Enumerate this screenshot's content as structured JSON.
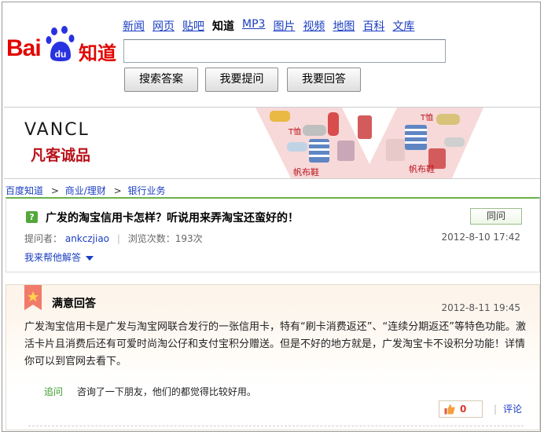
{
  "header": {
    "logo_text_latin": "Bai",
    "logo_text_du": "du",
    "logo_text_cn": "知道",
    "nav": [
      "新闻",
      "网页",
      "贴吧",
      "知道",
      "MP3",
      "图片",
      "视频",
      "地图",
      "百科",
      "文库"
    ],
    "nav_active_index": 3,
    "search_value": "",
    "buttons": {
      "search": "搜索答案",
      "ask": "我要提问",
      "answer": "我要回答"
    }
  },
  "banner": {
    "brand": "VANCL",
    "slogan": "凡客诚品",
    "product_labels": [
      "T恤",
      "T恤",
      "帆布鞋",
      "帆布鞋"
    ]
  },
  "breadcrumb": [
    "百度知道",
    "商业/理财",
    "银行业务"
  ],
  "question": {
    "icon": "question-icon",
    "title": "广发的淘宝信用卡怎样？听说用来弄淘宝还蛮好的！",
    "same_button": "同问",
    "asker_label": "提问者：",
    "asker": "ankczjiao",
    "views_label": "浏览次数：",
    "views": "193次",
    "date": "2012-8-10 17:42",
    "help_link": "我来帮他解答"
  },
  "answer": {
    "title": "满意回答",
    "date": "2012-8-11 19:45",
    "body": "广发淘宝信用卡是广发与淘宝网联合发行的一张信用卡，特有“刷卡消费返还”、“连续分期返还”等特色功能。激活卡片且消费后还有可爱时尚淘公仔和支付宝积分赠送。但是不好的地方就是，广发淘宝卡不设积分功能！详情你可以到官网去看下。",
    "followup_tag": "追问",
    "followup_text": "咨询了一下朋友，他们的都觉得比较好用。",
    "likes": "0",
    "comment_link": "评论"
  },
  "colors": {
    "baidu_red": "#e10602",
    "baidu_blue": "#2932e1",
    "link_blue": "#1a3dc1",
    "green_accent": "#6bb24d",
    "vancl_red": "#b8131b"
  }
}
